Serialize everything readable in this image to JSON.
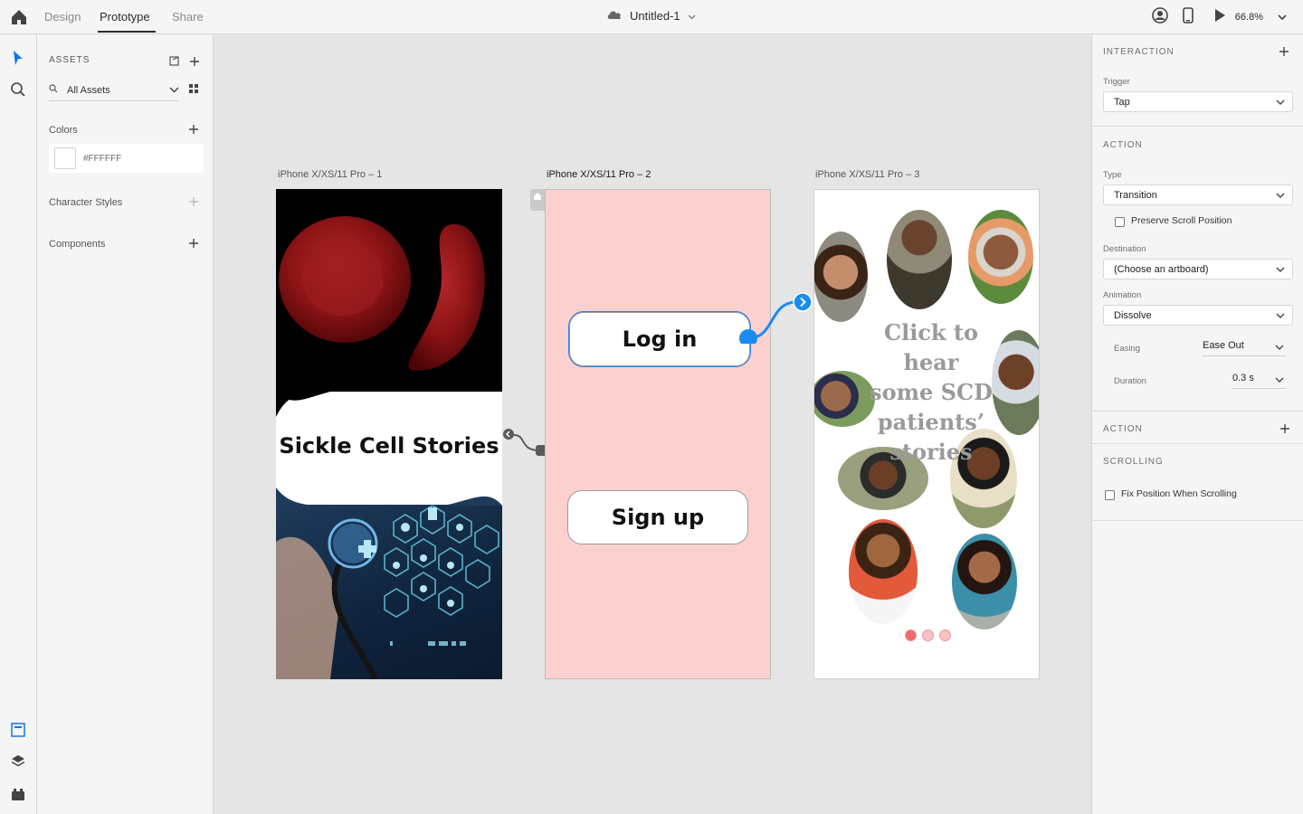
{
  "topbar": {
    "tabs": [
      "Design",
      "Prototype",
      "Share"
    ],
    "active_tab": "Prototype",
    "document_title": "Untitled-1",
    "zoom": "66.8%"
  },
  "assets": {
    "header": "ASSETS",
    "filter": "All Assets",
    "colors_label": "Colors",
    "color_value": "#FFFFFF",
    "character_styles_label": "Character Styles",
    "components_label": "Components"
  },
  "canvas": {
    "artboards": [
      {
        "label": "iPhone X/XS/11 Pro – 1"
      },
      {
        "label": "iPhone X/XS/11 Pro – 2"
      },
      {
        "label": "iPhone X/XS/11 Pro – 3"
      }
    ],
    "artboard1": {
      "title": "Sickle Cell Stories"
    },
    "artboard2": {
      "login": "Log in",
      "signup": "Sign up",
      "bg": "#fdd0d0"
    },
    "artboard3": {
      "headline_lines": [
        "Click to hear",
        "some SCD",
        "patients’",
        "stories"
      ]
    }
  },
  "props": {
    "interaction_title": "INTERACTION",
    "trigger_label": "Trigger",
    "trigger_value": "Tap",
    "action_title": "ACTION",
    "type_label": "Type",
    "type_value": "Transition",
    "preserve_scroll": "Preserve Scroll Position",
    "destination_label": "Destination",
    "destination_value": "(Choose an artboard)",
    "animation_label": "Animation",
    "animation_value": "Dissolve",
    "easing_label": "Easing",
    "easing_value": "Ease Out",
    "duration_label": "Duration",
    "duration_value": "0.3 s",
    "action2_title": "ACTION",
    "scrolling_title": "SCROLLING",
    "fix_position": "Fix Position When Scrolling"
  },
  "colors": {
    "accent": "#2680eb",
    "wire": "#1a8cf0",
    "artboard2_bg": "#fdd0d0"
  }
}
